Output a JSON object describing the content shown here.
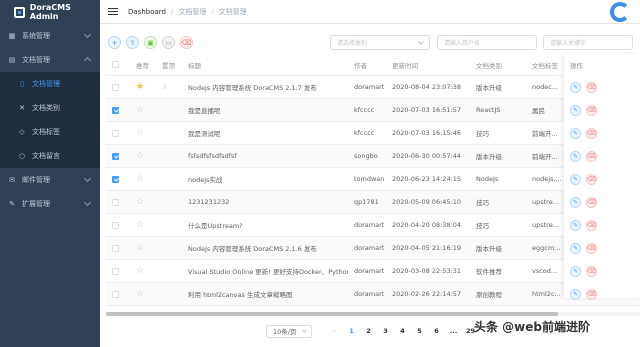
{
  "app": {
    "title": "DoraCMS Admin"
  },
  "sidebar": {
    "items": [
      {
        "label": "系统管理",
        "icon": "grid-icon"
      },
      {
        "label": "文档管理",
        "icon": "document-icon",
        "expanded": true,
        "children": [
          {
            "label": "文档管理",
            "icon": "file-icon",
            "active": true
          },
          {
            "label": "文档类别",
            "icon": "category-icon"
          },
          {
            "label": "文档标签",
            "icon": "tag-icon"
          },
          {
            "label": "文档留言",
            "icon": "comment-icon"
          }
        ]
      },
      {
        "label": "邮件管理",
        "icon": "mail-icon"
      },
      {
        "label": "扩展管理",
        "icon": "puzzle-icon"
      }
    ]
  },
  "breadcrumb": [
    "Dashboard",
    "文档管理",
    "文档管理"
  ],
  "toolbar": {
    "category_placeholder": "请选择类别",
    "user_placeholder": "请输入用户名",
    "keyword_placeholder": "请输入关键字"
  },
  "table": {
    "headers": [
      "推荐",
      "置顶",
      "标题",
      "作者",
      "更新时间",
      "文档类别",
      "文档标签",
      "操作"
    ],
    "rows": [
      {
        "checked": false,
        "recommended": true,
        "top": true,
        "title": "Nodejs 内容管理系统 DoraCMS 2.1.7 发布",
        "author": "doramart",
        "time": "2020-08-04 23:07:38",
        "category": "版本升级",
        "tag": "nodec..."
      },
      {
        "checked": true,
        "recommended": false,
        "top": false,
        "title": "我是直播呢",
        "author": "kfcccc",
        "time": "2020-07-03 16:51:57",
        "category": "ReactJS",
        "tag": "属民"
      },
      {
        "checked": false,
        "recommended": false,
        "top": false,
        "title": "我是测试呢",
        "author": "kfcccc",
        "time": "2020-07-03 16:15:46",
        "category": "技巧",
        "tag": "前端开..."
      },
      {
        "checked": true,
        "recommended": false,
        "top": false,
        "title": "fsfsdfsfsdfsdfsf",
        "author": "songbo",
        "time": "2020-06-30 00:57:44",
        "category": "版本升级",
        "tag": "前端开..."
      },
      {
        "checked": true,
        "recommended": false,
        "top": false,
        "title": "nodejs实战",
        "author": "tomdwan",
        "time": "2020-06-23 14:24:15",
        "category": "NodeJs",
        "tag": "nodejs,..."
      },
      {
        "checked": false,
        "recommended": false,
        "top": false,
        "title": "1231231232",
        "author": "qp1781",
        "time": "2020-05-09 06:45:10",
        "category": "技巧",
        "tag": "upstre..."
      },
      {
        "checked": false,
        "recommended": false,
        "top": false,
        "title": "什么是Upstream?",
        "author": "doramart",
        "time": "2020-04-20 08:38:04",
        "category": "技巧",
        "tag": "upstre..."
      },
      {
        "checked": false,
        "recommended": false,
        "top": false,
        "title": "Nodejs 内容管理系统 DoraCMS 2.1.6 发布",
        "author": "doramart",
        "time": "2020-04-05 21:16:19",
        "category": "版本升级",
        "tag": "eggcm..."
      },
      {
        "checked": false,
        "recommended": false,
        "top": false,
        "title": "Visual Studio Online 更新! 更好支持Docker、Python、...",
        "author": "doramart",
        "time": "2020-03-08 22:53:31",
        "category": "软件推荐",
        "tag": "vscod..."
      },
      {
        "checked": false,
        "recommended": false,
        "top": false,
        "title": "利用 html2canvas 生成文章缩略图",
        "author": "doramart",
        "time": "2020-02-26 22:14:57",
        "category": "原创教程",
        "tag": "html2c..."
      }
    ]
  },
  "pagination": {
    "page_size": "10条/页",
    "pages": [
      "1",
      "2",
      "3",
      "4",
      "5",
      "6",
      "...",
      "29"
    ],
    "current": "1"
  },
  "watermark": "头条 @web前端进阶",
  "colors": {
    "sidebar": "#304156",
    "accent": "#409eff",
    "danger": "#f56c6c",
    "star": "#f7ba2a"
  }
}
